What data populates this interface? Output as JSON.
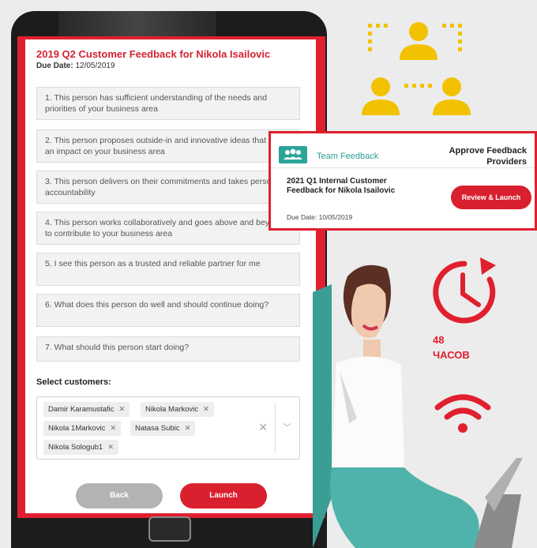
{
  "form": {
    "title": "2019 Q2 Customer Feedback for Nikola Isailovic",
    "due_label": "Due Date:",
    "due_value": "12/05/2019",
    "questions": [
      "1. This person has sufficient understanding of the needs and priorities of your business area",
      "2. This person proposes outside-in and innovative ideas that make an impact on your business area",
      "3. This person delivers on their commitments and takes personal accountability",
      "4. This person works collaboratively and goes above and beyond to contribute to your business area",
      "5. I see this person as a trusted and reliable partner for me",
      "6. What does this person do well and should continue doing?",
      "7. What should this person start doing?"
    ],
    "select_label": "Select customers:",
    "customers": [
      "Damir Karamustafic",
      "Nikola Markovic",
      "Nikola 1Markovic",
      "Natasa Subic",
      "Nikola Sologub1"
    ],
    "back_label": "Back",
    "launch_label": "Launch"
  },
  "card": {
    "team_label": "Team Feedback",
    "approve_label": "Approve Feedback Providers",
    "feedback_title": "2021 Q1 Internal Customer Feedback for Nikola Isailovic",
    "due": "Due Date: 10/05/2019",
    "button_label": "Review & Launch"
  },
  "hours": {
    "number": "48",
    "unit": "ЧАСОВ"
  },
  "colors": {
    "accent_red": "#e0202e",
    "team_yellow": "#f2c200",
    "teal": "#2aa597"
  },
  "icons": [
    "team-network-icon",
    "clock-refresh-icon",
    "wifi-icon",
    "team-feedback-icon",
    "chevron-down-icon",
    "close-icon"
  ]
}
